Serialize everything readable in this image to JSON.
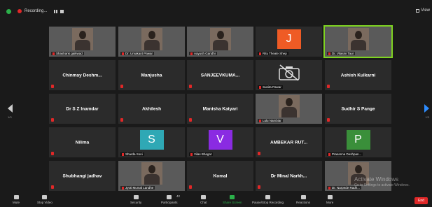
{
  "recording": {
    "label": "Recording..."
  },
  "view_label": "View",
  "pagination": {
    "left": "1/3",
    "right": "1/3"
  },
  "tiles": [
    {
      "name": "Shashank gaikwad",
      "kind": "video"
    },
    {
      "name": "Dr. Umakant Pawar",
      "kind": "video"
    },
    {
      "name": "Aayush Gandhi",
      "kind": "video"
    },
    {
      "name": "Ritu Theale Shep",
      "kind": "letter",
      "letter": "J",
      "color": "#ef5b25"
    },
    {
      "name": "Dr. Vilasini Taur",
      "kind": "video",
      "active": true
    },
    {
      "name": "Chinmay  Deshm...",
      "kind": "name"
    },
    {
      "name": "Manjusha",
      "kind": "name"
    },
    {
      "name": "SANJEEVKUMA...",
      "kind": "name"
    },
    {
      "name": "Sunita Pawar",
      "kind": "camoff"
    },
    {
      "name": "Ashish Kulkarni",
      "kind": "name"
    },
    {
      "name": "Dr S Z Inamdar",
      "kind": "name"
    },
    {
      "name": "Akhilesh",
      "kind": "name"
    },
    {
      "name": "Manisha Katyari",
      "kind": "name"
    },
    {
      "name": "Lulu Nambiar",
      "kind": "video"
    },
    {
      "name": "Sudhir S Pange",
      "kind": "name"
    },
    {
      "name": "Nilima",
      "kind": "name"
    },
    {
      "name": "Sharda Soni",
      "kind": "letter",
      "letter": "S",
      "color": "#2fa8b5"
    },
    {
      "name": "Vilas Bhagat",
      "kind": "letter",
      "letter": "V",
      "color": "#8a2be2"
    },
    {
      "name": "AMBEKAR RUT...",
      "kind": "name"
    },
    {
      "name": "Prasanna Deshpan...",
      "kind": "letter",
      "letter": "P",
      "color": "#3a8f3a"
    },
    {
      "name": "Shubhangi jadhav",
      "kind": "name"
    },
    {
      "name": "Jyoti Mumal Landhe",
      "kind": "video"
    },
    {
      "name": "Komal",
      "kind": "name"
    },
    {
      "name": "Dr Minal  Narkh...",
      "kind": "name"
    },
    {
      "name": "Dr. Narpede Radh...",
      "kind": "video"
    }
  ],
  "toolbar": {
    "mute": "Mute",
    "stop_video": "Stop Video",
    "security": "Security",
    "participants": "Participants",
    "participants_count": "42",
    "chat": "Chat",
    "share_screen": "Share Screen",
    "pause_recording": "Pause/Stop Recording",
    "reactions": "Reactions",
    "more": "More",
    "end": "End"
  },
  "watermark": {
    "line1": "Activate Windows",
    "line2": "Go to Settings to activate Windows."
  }
}
